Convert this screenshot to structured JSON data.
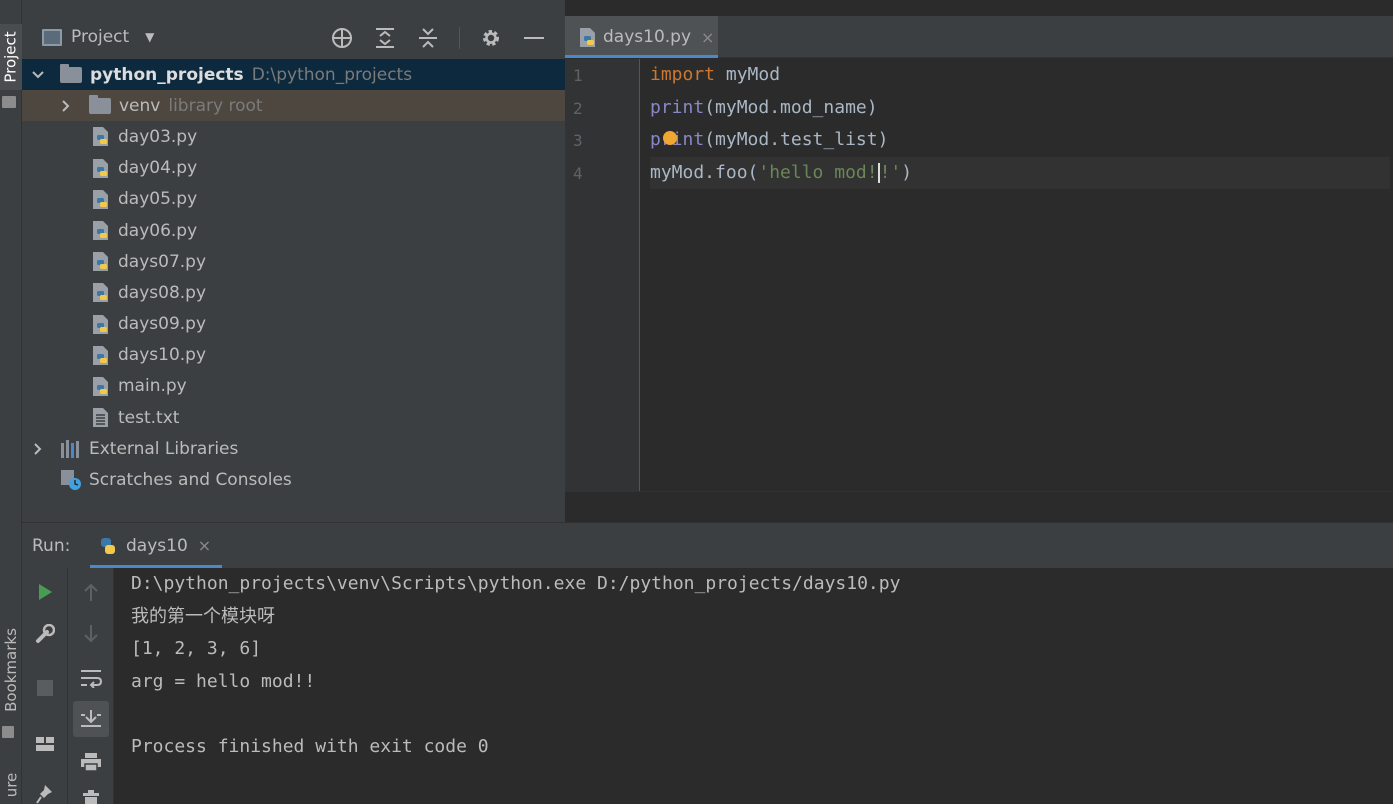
{
  "left_strip": {
    "project_tab": "Project",
    "bookmarks_tab": "Bookmarks",
    "structure_tab": "ure"
  },
  "project_panel": {
    "title": "Project",
    "tree": {
      "root_name": "python_projects",
      "root_path": "D:\\python_projects",
      "venv_name": "venv",
      "venv_hint": "library root",
      "files": [
        "day03.py",
        "day04.py",
        "day05.py",
        "day06.py",
        "days07.py",
        "days08.py",
        "days09.py",
        "days10.py",
        "main.py",
        "test.txt"
      ],
      "external_libraries": "External Libraries",
      "scratches": "Scratches and Consoles"
    }
  },
  "editor": {
    "tab_label": "days10.py",
    "tab_close": "×",
    "line_numbers": [
      "1",
      "2",
      "3",
      "4"
    ],
    "line1": {
      "kw": "import",
      "rest": " myMod"
    },
    "line2": {
      "fn": "print",
      "rest": "(myMod.mod_name)"
    },
    "line3": {
      "fn": "print",
      "rest": "(myMod.test_list)"
    },
    "line4": {
      "pre": "myMod.foo(",
      "str_a": "'hello mod!",
      "str_b": "!'",
      "post": ")"
    }
  },
  "run": {
    "label": "Run:",
    "tab_label": "days10",
    "tab_close": "×",
    "output": [
      "D:\\python_projects\\venv\\Scripts\\python.exe D:/python_projects/days10.py",
      "我的第一个模块呀",
      "[1, 2, 3, 6]",
      "arg = hello mod!!",
      "",
      "Process finished with exit code 0"
    ]
  },
  "colors": {
    "keyword": "#cc7832",
    "builtin": "#8888c6",
    "string": "#6a8759",
    "accent": "#4a88c7",
    "run_green": "#499c54"
  }
}
